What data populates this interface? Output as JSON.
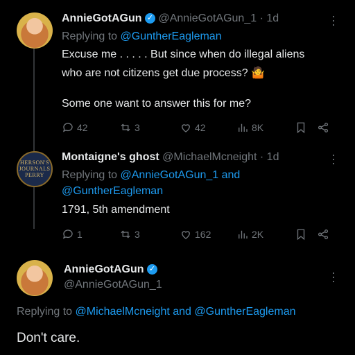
{
  "tweet1": {
    "author_name": "AnnieGotAGun",
    "handle": "@AnnieGotAGun_1",
    "time": "· 1d",
    "replying_prefix": "Replying to ",
    "replying_to": "@GuntherEagleman",
    "text_line1": "Excuse me . . . . . But since when do illegal aliens",
    "text_line2": "who are not citizens get due process? 🤷",
    "text_line3": "Some one want to answer this for me?",
    "replies": "42",
    "reposts": "3",
    "likes": "42",
    "views": "8K"
  },
  "tweet2": {
    "author_name": "Montaigne's ghost",
    "handle": "@MichaelMcneight",
    "time": "· 1d",
    "avatar_text": "HERSON'S JOURNALS PERRY",
    "replying_prefix": "Replying to ",
    "replying_to_1": "@AnnieGotAGun_1",
    "replying_and": " and",
    "replying_to_2": "@GuntherEagleman",
    "text": "1791, 5th amendment",
    "replies": "1",
    "reposts": "3",
    "likes": "162",
    "views": "2K"
  },
  "tweet3": {
    "author_name": "AnnieGotAGun",
    "handle": "@AnnieGotAGun_1",
    "replying_prefix": "Replying to ",
    "replying_to_1": "@MichaelMcneight",
    "replying_and": " and ",
    "replying_to_2": "@GuntherEagleman",
    "text": "Don't care."
  },
  "colors": {
    "background": "#000000",
    "text": "#e7e9ea",
    "muted": "#71767b",
    "link": "#1d9bf0",
    "verified": "#1d9bf0"
  },
  "icons": [
    "reply-icon",
    "repost-icon",
    "like-icon",
    "views-icon",
    "bookmark-icon",
    "share-icon",
    "more-icon",
    "verified-badge-icon"
  ]
}
